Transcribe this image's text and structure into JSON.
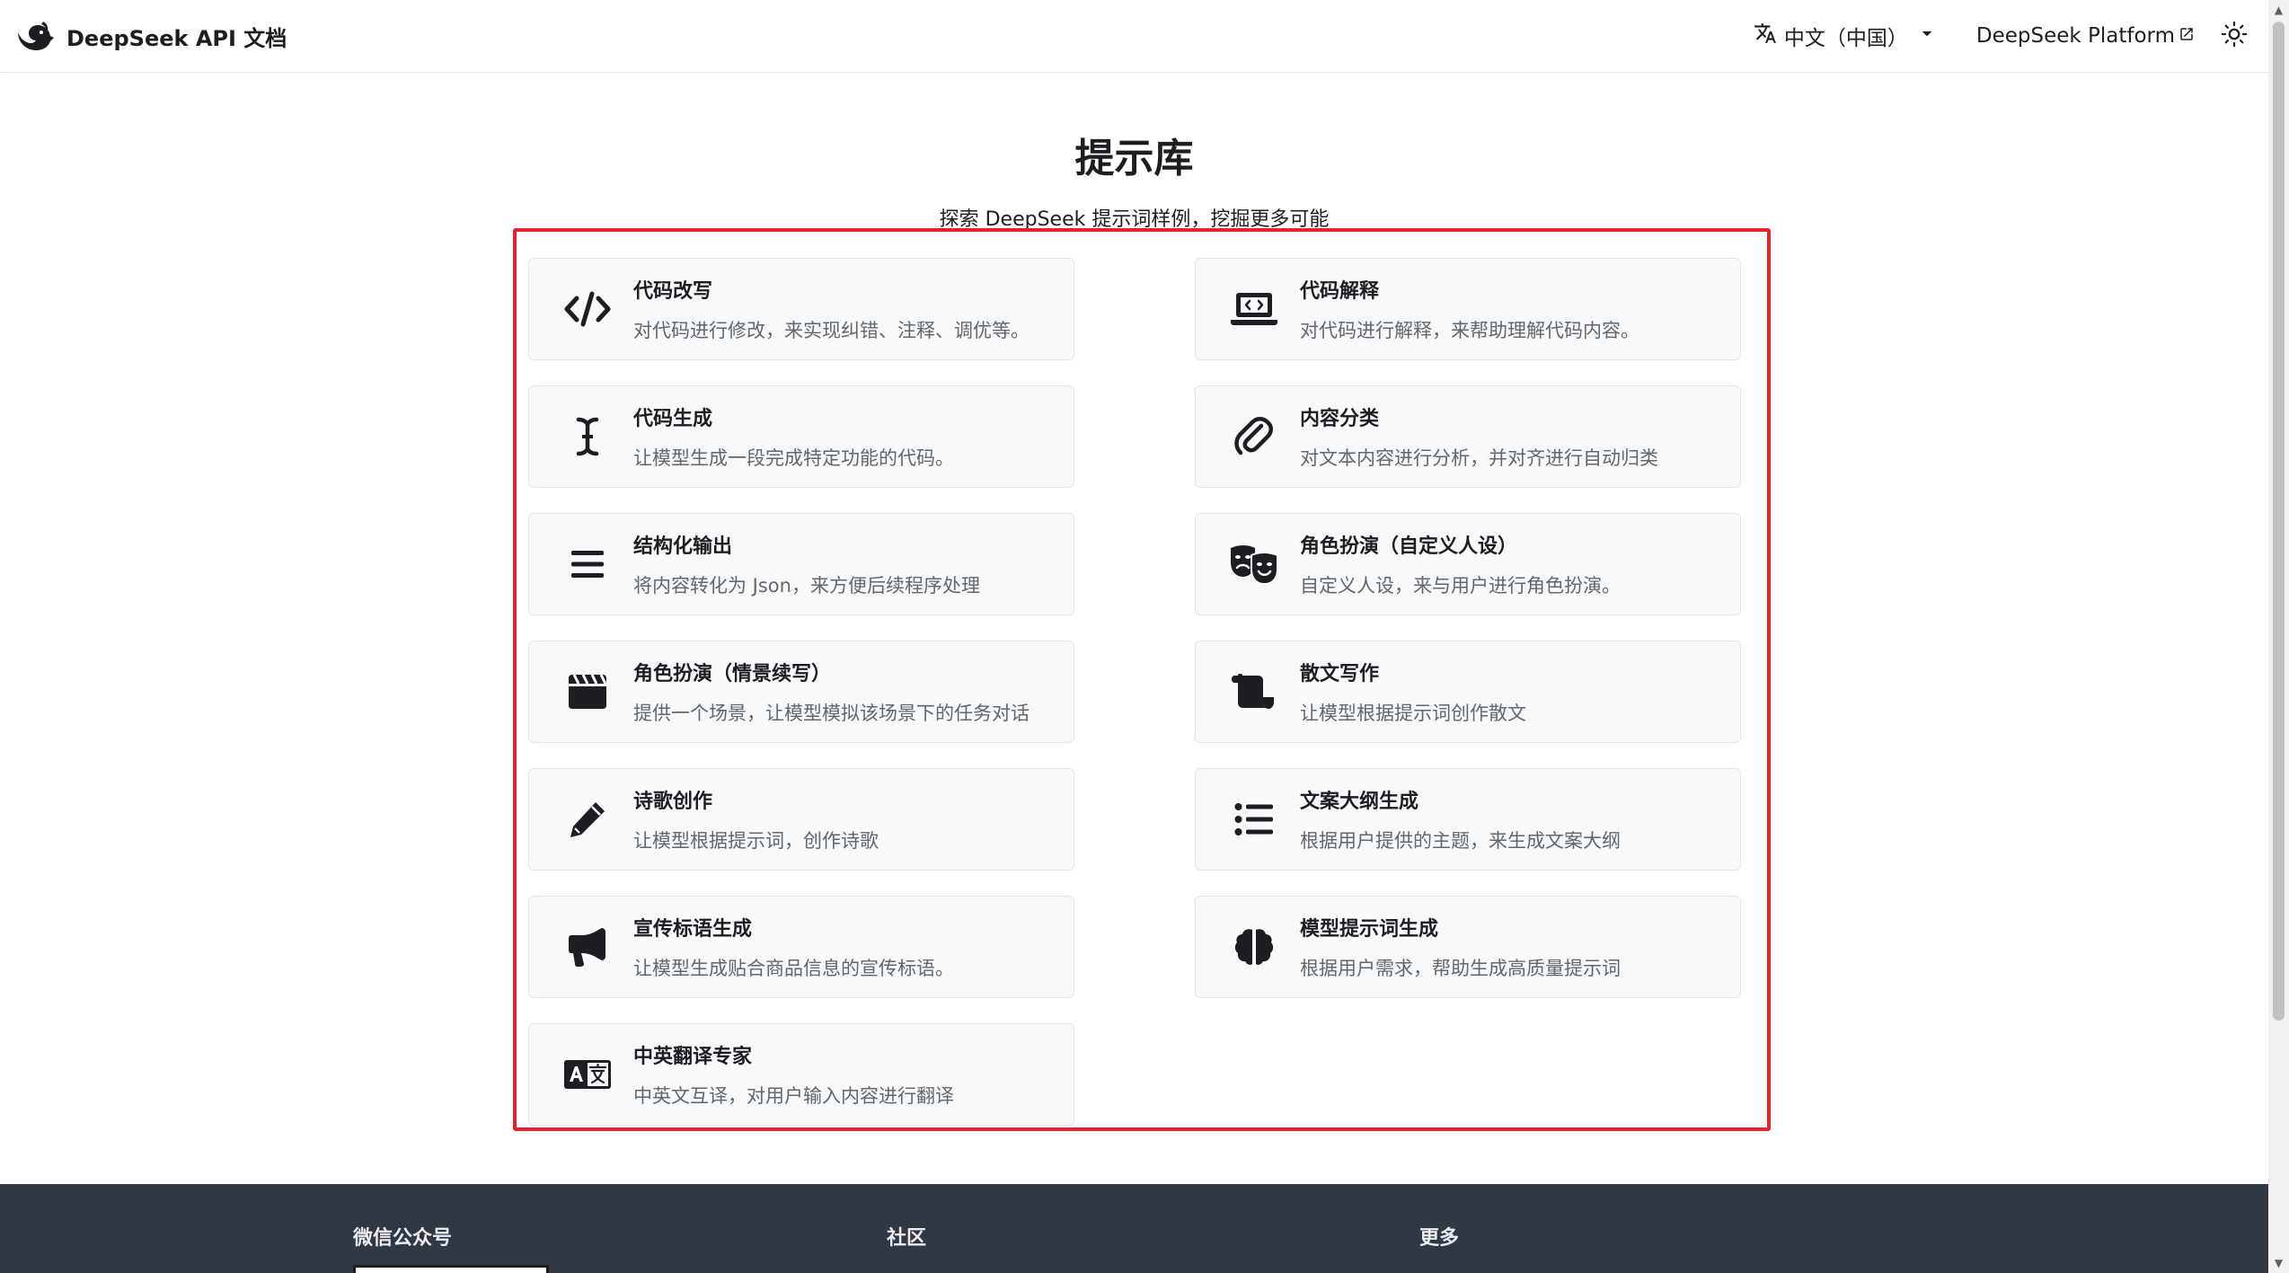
{
  "navbar": {
    "brand_title": "DeepSeek API 文档",
    "language": "中文（中国）",
    "platform_link": "DeepSeek Platform"
  },
  "header": {
    "title": "提示库",
    "subtitle": "探索 DeepSeek 提示词样例，挖掘更多可能"
  },
  "cards": [
    {
      "title": "代码改写",
      "desc": "对代码进行修改，来实现纠错、注释、调优等。",
      "icon": "code-icon"
    },
    {
      "title": "代码解释",
      "desc": "对代码进行解释，来帮助理解代码内容。",
      "icon": "laptop-code-icon"
    },
    {
      "title": "代码生成",
      "desc": "让模型生成一段完成特定功能的代码。",
      "icon": "i-cursor-icon"
    },
    {
      "title": "内容分类",
      "desc": "对文本内容进行分析，并对齐进行自动归类",
      "icon": "paperclip-icon"
    },
    {
      "title": "结构化输出",
      "desc": "将内容转化为 Json，来方便后续程序处理",
      "icon": "bars-icon"
    },
    {
      "title": "角色扮演（自定义人设）",
      "desc": "自定义人设，来与用户进行角色扮演。",
      "icon": "masks-theater-icon"
    },
    {
      "title": "角色扮演（情景续写）",
      "desc": "提供一个场景，让模型模拟该场景下的任务对话",
      "icon": "clapperboard-icon"
    },
    {
      "title": "散文写作",
      "desc": "让模型根据提示词创作散文",
      "icon": "scroll-icon"
    },
    {
      "title": "诗歌创作",
      "desc": "让模型根据提示词，创作诗歌",
      "icon": "pencil-icon"
    },
    {
      "title": "文案大纲生成",
      "desc": "根据用户提供的主题，来生成文案大纲",
      "icon": "list-icon"
    },
    {
      "title": "宣传标语生成",
      "desc": "让模型生成贴合商品信息的宣传标语。",
      "icon": "bullhorn-icon"
    },
    {
      "title": "模型提示词生成",
      "desc": "根据用户需求，帮助生成高质量提示词",
      "icon": "brain-icon"
    },
    {
      "title": "中英翻译专家",
      "desc": "中英文互译，对用户输入内容进行翻译",
      "icon": "language-icon"
    }
  ],
  "footer": {
    "col1": "微信公众号",
    "col2": "社区",
    "col3": "更多"
  },
  "colors": {
    "highlight_border": "#e5212b",
    "footer_bg": "#303846",
    "card_bg": "#f8f9fa"
  }
}
